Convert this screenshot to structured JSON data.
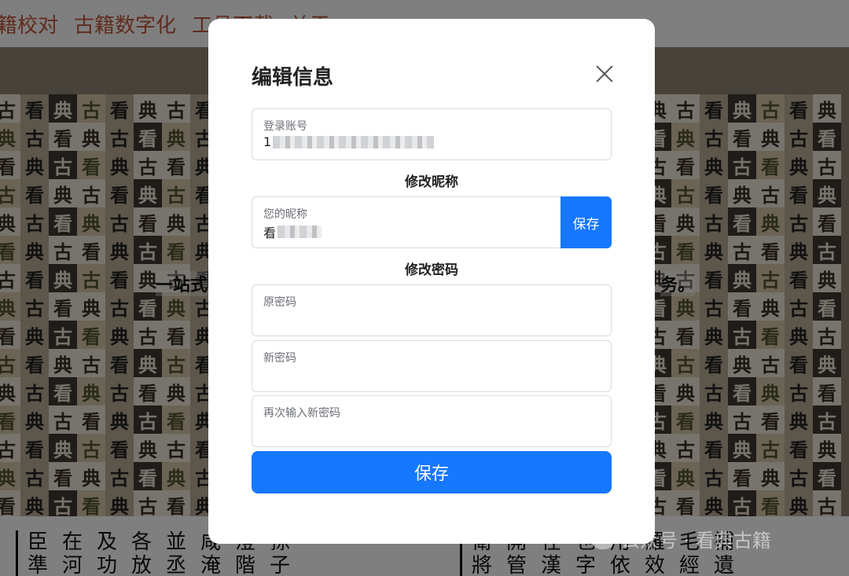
{
  "background": {
    "nav_items": [
      "籍校对",
      "古籍数字化",
      "工具下载",
      "关于"
    ],
    "banner_text_left": "一站式",
    "banner_text_right": "务。",
    "tile_chars": [
      "古",
      "典",
      "看"
    ],
    "watermark": "公众号 · 看典古籍",
    "book_left_cols": [
      [
        "臣",
        "準"
      ],
      [
        "在",
        "河"
      ],
      [
        "及",
        "功"
      ],
      [
        "各",
        "放"
      ],
      [
        "並",
        "丞"
      ],
      [
        "咸",
        "淹"
      ],
      [
        "澄",
        "階"
      ],
      [
        "孫",
        "子"
      ]
    ],
    "book_right_cols": [
      [
        "衛",
        "將"
      ],
      [
        "開",
        "管"
      ],
      [
        "在",
        "漢"
      ],
      [
        "也",
        "字"
      ],
      [
        "用",
        "依"
      ],
      [
        "羅",
        "效"
      ],
      [
        "毛",
        "經"
      ],
      [
        "補",
        "遺"
      ]
    ]
  },
  "modal": {
    "title": "编辑信息",
    "account_field": {
      "label": "登录账号",
      "value": "1"
    },
    "nickname_section_title": "修改昵称",
    "nickname_field": {
      "label": "您的昵称",
      "value": "看"
    },
    "nickname_save_label": "保存",
    "password_section_title": "修改密码",
    "old_password": {
      "placeholder": "原密码"
    },
    "new_password": {
      "placeholder": "新密码"
    },
    "confirm_password": {
      "placeholder": "再次输入新密码"
    },
    "save_label": "保存"
  },
  "colors": {
    "primary": "#1677ff",
    "nav_text": "#c0573a"
  }
}
